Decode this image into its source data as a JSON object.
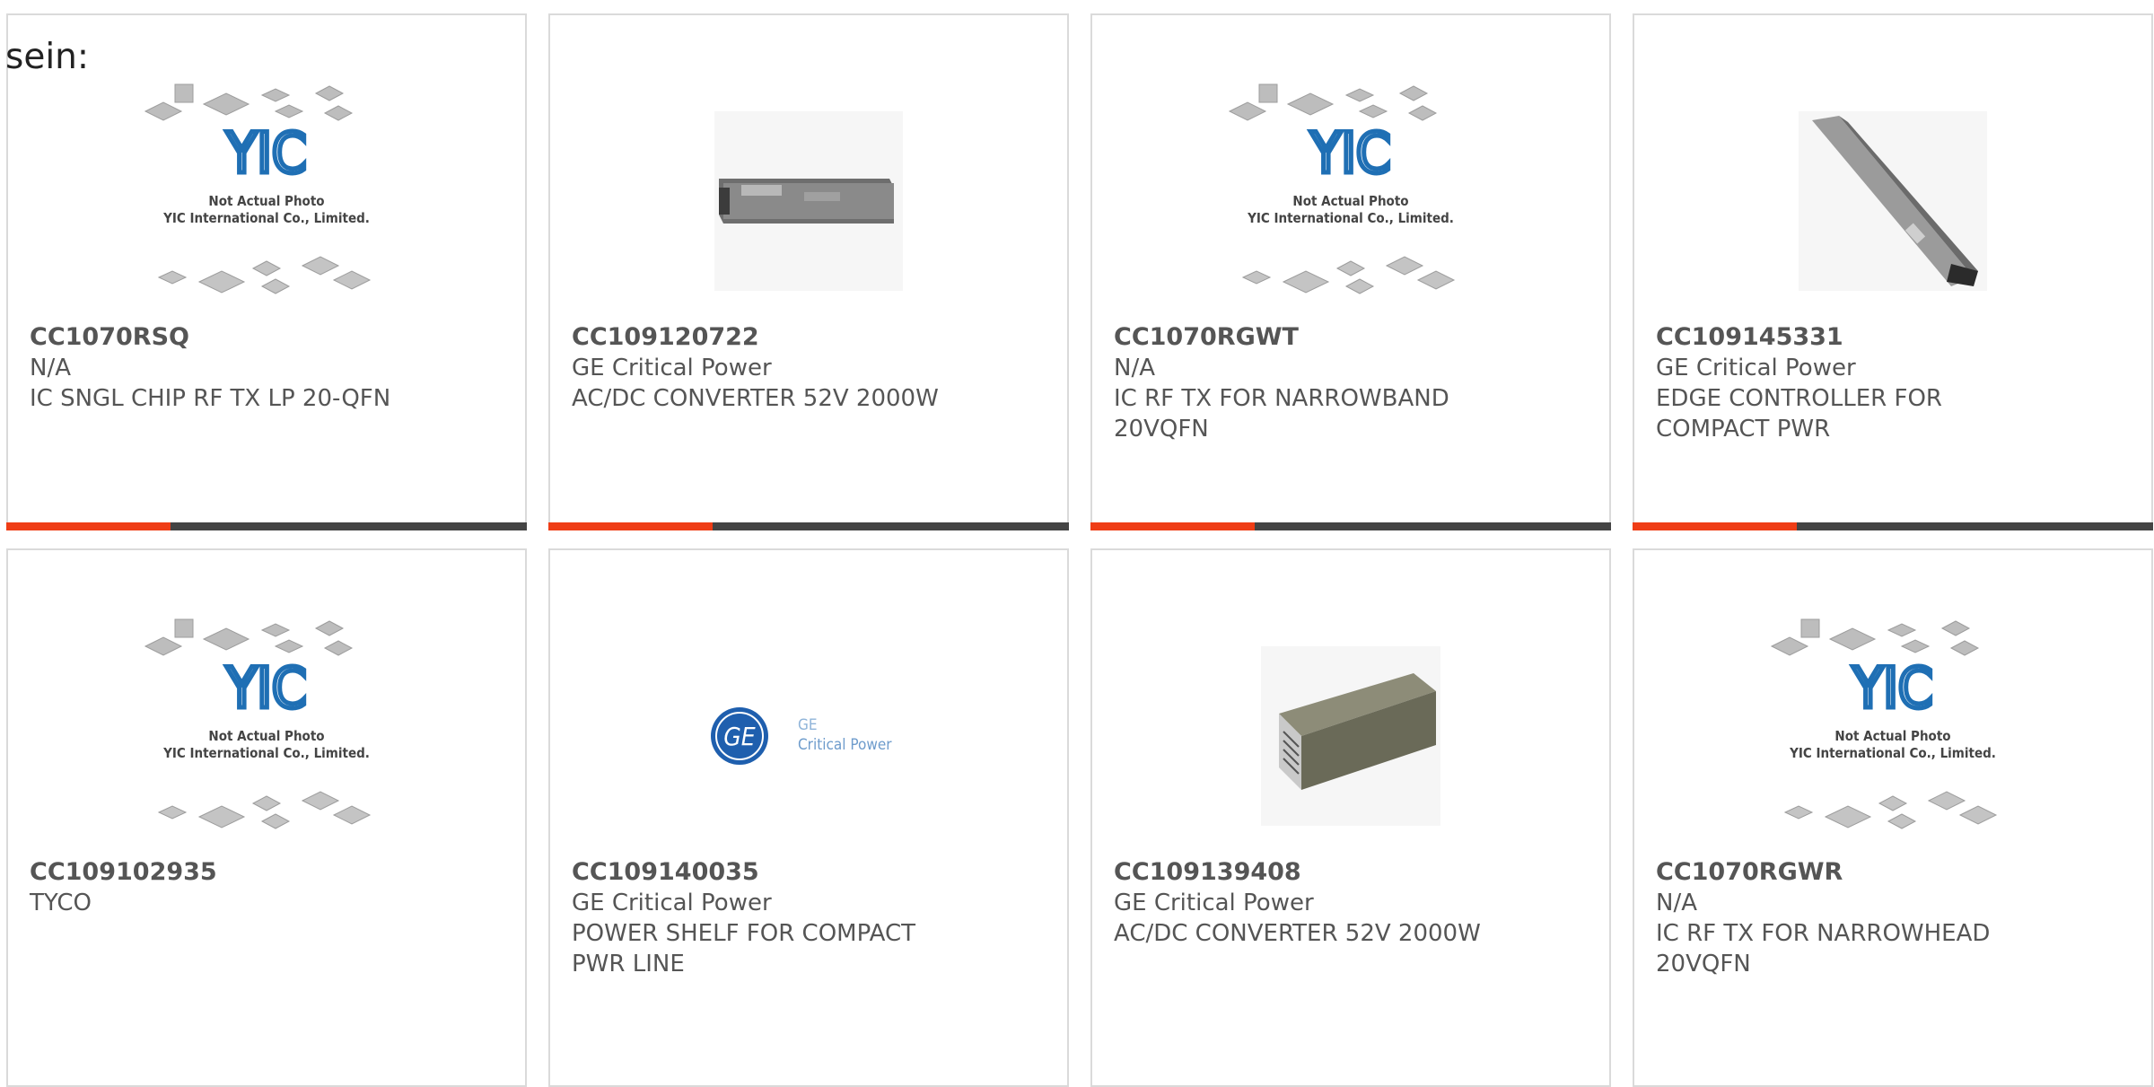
{
  "intro_text": "sein:",
  "placeholder": {
    "brand": "YIC",
    "line1": "Not Actual Photo",
    "line2": "YIC International Co., Limited."
  },
  "ge_logo": {
    "monogram": "GE",
    "line1": "GE",
    "line2": "Critical Power"
  },
  "products": [
    {
      "part": "CC1070RSQ",
      "maker": "N/A",
      "desc1": "IC SNGL CHIP RF TX LP 20-QFN",
      "desc2": "",
      "image": "yic-placeholder"
    },
    {
      "part": "CC109120722",
      "maker": "GE Critical Power",
      "desc1": "AC/DC CONVERTER 52V 2000W",
      "desc2": "",
      "image": "power-supply-photo"
    },
    {
      "part": "CC1070RGWT",
      "maker": "N/A",
      "desc1": "IC RF TX FOR NARROWBAND",
      "desc2": "20VQFN",
      "image": "yic-placeholder"
    },
    {
      "part": "CC109145331",
      "maker": "GE Critical Power",
      "desc1": "EDGE CONTROLLER FOR",
      "desc2": "COMPACT PWR",
      "image": "edge-controller-photo"
    },
    {
      "part": "CC109102935",
      "maker": "TYCO",
      "desc1": "",
      "desc2": "",
      "image": "yic-placeholder"
    },
    {
      "part": "CC109140035",
      "maker": "GE Critical Power",
      "desc1": "POWER SHELF FOR COMPACT",
      "desc2": "PWR LINE",
      "image": "ge-logo"
    },
    {
      "part": "CC109139408",
      "maker": "GE Critical Power",
      "desc1": "AC/DC CONVERTER 52V 2000W",
      "desc2": "",
      "image": "converter-module-photo"
    },
    {
      "part": "CC1070RGWR",
      "maker": "N/A",
      "desc1": "IC RF TX FOR NARROWHEAD",
      "desc2": "20VQFN",
      "image": "yic-placeholder"
    }
  ],
  "colors": {
    "accent": "#ef3d16",
    "bar": "#444444",
    "text": "#555555",
    "border": "#dadada",
    "brand_blue": "#1f6fb4"
  }
}
